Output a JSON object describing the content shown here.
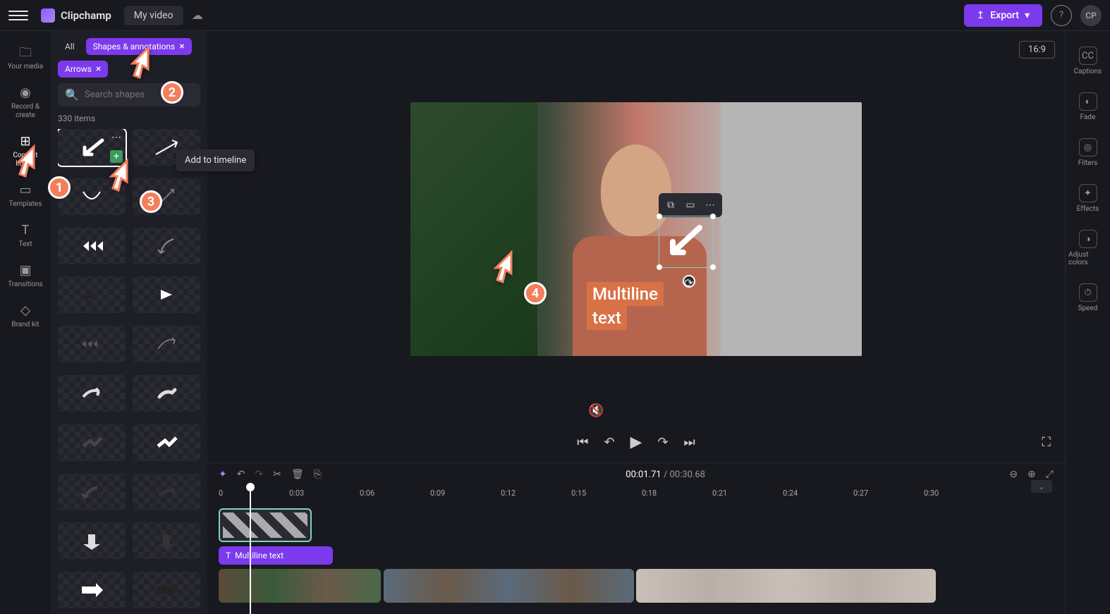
{
  "header": {
    "app_name": "Clipchamp",
    "project_name": "My video",
    "export_label": "Export",
    "avatar_initials": "CP"
  },
  "left_rail": {
    "items": [
      {
        "label": "Your media"
      },
      {
        "label": "Record & create"
      },
      {
        "label": "Content library"
      },
      {
        "label": "Templates"
      },
      {
        "label": "Text"
      },
      {
        "label": "Transitions"
      },
      {
        "label": "Brand kit"
      }
    ]
  },
  "side_panel": {
    "chip_all": "All",
    "chip_shapes": "Shapes & annotations",
    "chip_arrows": "Arrows",
    "search_placeholder": "Search shapes",
    "item_count": "330 items",
    "tooltip": "Add to timeline"
  },
  "preview": {
    "aspect": "16:9",
    "multiline_1": "Multiline",
    "multiline_2": "text"
  },
  "right_rail": {
    "items": [
      {
        "label": "Captions"
      },
      {
        "label": "Fade"
      },
      {
        "label": "Filters"
      },
      {
        "label": "Effects"
      },
      {
        "label": "Adjust colors"
      },
      {
        "label": "Speed"
      }
    ]
  },
  "timeline": {
    "current_time": "00:01.71",
    "duration": "00:30.68",
    "ruler": [
      "0",
      "0:03",
      "0:06",
      "0:09",
      "0:12",
      "0:15",
      "0:18",
      "0:21",
      "0:24",
      "0:27",
      "0:30"
    ],
    "text_clip_label": "Multiline text"
  },
  "pointers": {
    "p1": "1",
    "p2": "2",
    "p3": "3",
    "p4": "4"
  }
}
